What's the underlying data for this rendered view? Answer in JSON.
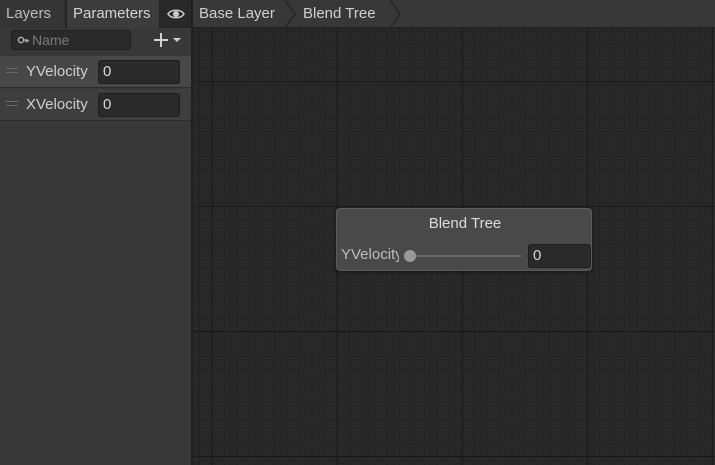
{
  "tabs": {
    "layers": "Layers",
    "parameters": "Parameters"
  },
  "search": {
    "placeholder": "Name",
    "value": ""
  },
  "parameters": [
    {
      "name": "YVelocity",
      "value": "0"
    },
    {
      "name": "XVelocity",
      "value": "0"
    }
  ],
  "breadcrumb": [
    "Base Layer",
    "Blend Tree"
  ],
  "node": {
    "title": "Blend Tree",
    "parameter": "YVelocity",
    "value": "0",
    "slider_level": 0
  },
  "icons": {
    "visibility": "eye-icon",
    "add": "plus-icon",
    "dropdown": "chevron-down-icon",
    "search": "search-icon"
  }
}
